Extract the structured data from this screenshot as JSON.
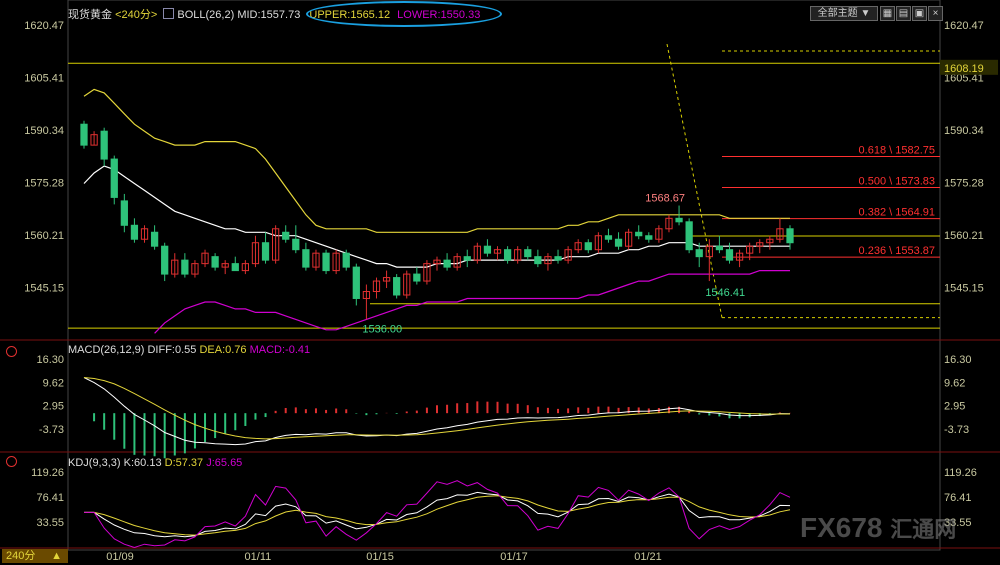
{
  "header": {
    "symbol": "现货黄金",
    "period": "<240分>",
    "indicator": "BOLL(26,2)",
    "mid": "MID:1557.73",
    "upper": "UPPER:1565.12",
    "lower": "LOWER:1550.33",
    "theme_label": "全部主题",
    "theme_arrow": "▼"
  },
  "macd_header": {
    "title": "MACD(26,12,9)",
    "diff": "DIFF:0.55",
    "dea": "DEA:0.76",
    "macd": "MACD:-0.41"
  },
  "kdj_header": {
    "title": "KDJ(9,3,3)",
    "k": "K:60.13",
    "d": "D:57.37",
    "j": "J:65.65"
  },
  "period_badge": "240分",
  "watermark": "FX678",
  "watermark_cn": "汇通网",
  "colors": {
    "up": "#e03030",
    "down": "#2ec27a",
    "boll_mid": "#ffffff",
    "boll_upper": "#e3d53a",
    "boll_lower": "#d000d0",
    "fib": "#ff3030",
    "level": "#d8d000"
  },
  "chart_data": [
    {
      "type": "candlestick",
      "title": "现货黄金 240分",
      "y_ticks": [
        "1620.47",
        "1605.41",
        "1590.34",
        "1575.28",
        "1560.21",
        "1545.15"
      ],
      "y_tick_values": [
        1620.47,
        1605.41,
        1590.34,
        1575.28,
        1560.21,
        1545.15
      ],
      "right_extra_tick": "1608.19",
      "ylim": [
        1532.5,
        1625
      ],
      "x_labels": [
        "01/09",
        "01/11",
        "01/15",
        "01/17",
        "01/21"
      ],
      "candles": [
        [
          1592,
          1593,
          1585,
          1586
        ],
        [
          1586,
          1590,
          1586,
          1589
        ],
        [
          1590,
          1591,
          1580,
          1582
        ],
        [
          1582,
          1583,
          1569,
          1571
        ],
        [
          1570,
          1572,
          1561,
          1563
        ],
        [
          1563,
          1565,
          1558,
          1559
        ],
        [
          1559,
          1563,
          1558,
          1562
        ],
        [
          1561,
          1563,
          1556,
          1557
        ],
        [
          1557,
          1558,
          1547,
          1549
        ],
        [
          1549,
          1555,
          1548,
          1553
        ],
        [
          1553,
          1555,
          1548,
          1549
        ],
        [
          1549,
          1553,
          1548,
          1552
        ],
        [
          1552,
          1556,
          1551,
          1555
        ],
        [
          1554,
          1555,
          1550,
          1551
        ],
        [
          1551,
          1553,
          1549,
          1552
        ],
        [
          1552,
          1554,
          1550,
          1550
        ],
        [
          1550,
          1553,
          1549,
          1552
        ],
        [
          1552,
          1560,
          1551,
          1558
        ],
        [
          1558,
          1561,
          1552,
          1553
        ],
        [
          1553,
          1563,
          1552,
          1562
        ],
        [
          1561,
          1563,
          1558,
          1559
        ],
        [
          1559,
          1563,
          1555,
          1556
        ],
        [
          1556,
          1558,
          1550,
          1551
        ],
        [
          1551,
          1556,
          1550,
          1555
        ],
        [
          1555,
          1556,
          1549,
          1550
        ],
        [
          1550,
          1556,
          1549,
          1555
        ],
        [
          1555,
          1556,
          1550,
          1551
        ],
        [
          1551,
          1552,
          1540,
          1542
        ],
        [
          1542,
          1546,
          1536,
          1544
        ],
        [
          1544,
          1548,
          1542,
          1547
        ],
        [
          1547,
          1550,
          1545,
          1548
        ],
        [
          1548,
          1549,
          1542,
          1543
        ],
        [
          1543,
          1550,
          1542,
          1549
        ],
        [
          1549,
          1551,
          1546,
          1547
        ],
        [
          1547,
          1553,
          1546,
          1552
        ],
        [
          1552,
          1554,
          1550,
          1553
        ],
        [
          1553,
          1555,
          1550,
          1551
        ],
        [
          1551,
          1555,
          1550,
          1554
        ],
        [
          1554,
          1556,
          1551,
          1553
        ],
        [
          1553,
          1558,
          1552,
          1557
        ],
        [
          1557,
          1559,
          1554,
          1555
        ],
        [
          1555,
          1557,
          1553,
          1556
        ],
        [
          1556,
          1557,
          1552,
          1553
        ],
        [
          1553,
          1557,
          1552,
          1556
        ],
        [
          1556,
          1557,
          1553,
          1554
        ],
        [
          1554,
          1556,
          1551,
          1552
        ],
        [
          1552,
          1555,
          1550,
          1554
        ],
        [
          1554,
          1556,
          1552,
          1553
        ],
        [
          1553,
          1557,
          1552,
          1556
        ],
        [
          1556,
          1559,
          1555,
          1558
        ],
        [
          1558,
          1559,
          1555,
          1556
        ],
        [
          1556,
          1561,
          1555,
          1560
        ],
        [
          1560,
          1562,
          1558,
          1559
        ],
        [
          1559,
          1561,
          1556,
          1557
        ],
        [
          1557,
          1562,
          1556,
          1561
        ],
        [
          1561,
          1563,
          1559,
          1560
        ],
        [
          1560,
          1561,
          1558,
          1559
        ],
        [
          1559,
          1563,
          1558,
          1562
        ],
        [
          1562,
          1566,
          1561,
          1565
        ],
        [
          1565,
          1568.67,
          1563,
          1564
        ],
        [
          1564,
          1565,
          1555,
          1556
        ],
        [
          1556,
          1558,
          1551,
          1554
        ],
        [
          1554,
          1559,
          1547,
          1557
        ],
        [
          1557,
          1560,
          1555,
          1556
        ],
        [
          1556,
          1558,
          1552,
          1553
        ],
        [
          1553,
          1556,
          1551,
          1555
        ],
        [
          1555,
          1558,
          1553,
          1557
        ],
        [
          1557,
          1559,
          1555,
          1558
        ],
        [
          1558,
          1560,
          1556,
          1559
        ],
        [
          1559,
          1565,
          1558,
          1562
        ],
        [
          1562,
          1563,
          1556,
          1558
        ]
      ],
      "boll": {
        "mid": [
          1575,
          1578,
          1580,
          1579,
          1577,
          1575,
          1573,
          1571,
          1569,
          1567,
          1566,
          1565,
          1564,
          1563,
          1562,
          1562,
          1561,
          1561,
          1561,
          1560,
          1560,
          1560,
          1559,
          1558,
          1557,
          1556,
          1555,
          1554,
          1553,
          1552,
          1552,
          1551,
          1551,
          1551,
          1551,
          1552,
          1552,
          1552,
          1553,
          1553,
          1553,
          1553,
          1553,
          1553,
          1553,
          1553,
          1553,
          1553,
          1554,
          1554,
          1554,
          1555,
          1555,
          1555,
          1556,
          1556,
          1557,
          1557,
          1558,
          1558,
          1558,
          1557,
          1557,
          1557,
          1557,
          1557,
          1557,
          1557,
          1557,
          1557,
          1557
        ],
        "upper": [
          1600,
          1602,
          1601,
          1598,
          1595,
          1592,
          1590,
          1588,
          1587,
          1586,
          1586,
          1586,
          1587,
          1587,
          1587,
          1587,
          1586,
          1585,
          1582,
          1578,
          1574,
          1570,
          1566,
          1563,
          1562,
          1562,
          1562,
          1562,
          1562,
          1561,
          1561,
          1561,
          1561,
          1561,
          1561,
          1561,
          1561,
          1561,
          1561,
          1562,
          1562,
          1562,
          1562,
          1562,
          1562,
          1562,
          1562,
          1562,
          1563,
          1563,
          1564,
          1564,
          1565,
          1566,
          1566,
          1566,
          1566,
          1566,
          1566,
          1566,
          1566,
          1566,
          1566,
          1566,
          1565,
          1565,
          1565,
          1565,
          1565,
          1565,
          1565
        ],
        "lower": [
          null,
          null,
          null,
          null,
          null,
          null,
          null,
          1532,
          1535,
          1537,
          1539,
          1540,
          1541,
          1541,
          1540,
          1539,
          1539,
          1538,
          1538,
          1538,
          1537,
          1536,
          1535,
          1534,
          1533,
          1533,
          1534,
          1535,
          1536,
          1537,
          1538,
          1539,
          1540,
          1540,
          1541,
          1541,
          1541,
          1541,
          1542,
          1542,
          1542,
          1542,
          1542,
          1542,
          1542,
          1542,
          1542,
          1542,
          1542,
          1542,
          1543,
          1543,
          1544,
          1545,
          1546,
          1547,
          1547,
          1548,
          1549,
          1549,
          1549,
          1549,
          1549,
          1549,
          1549,
          1549,
          1549,
          1550,
          1550,
          1550,
          1550
        ]
      },
      "fib_levels": [
        {
          "label": "0.618 \\ 1582.75",
          "value": 1582.75
        },
        {
          "label": "0.500 \\ 1573.83",
          "value": 1573.83
        },
        {
          "label": "0.382 \\ 1564.91",
          "value": 1564.91
        },
        {
          "label": "0.236 \\ 1553.87",
          "value": 1553.87
        }
      ],
      "annotations": [
        {
          "text": "1568.67",
          "value": 1568.67,
          "bar": 59
        },
        {
          "text": "1546.41",
          "value": 1546.41,
          "bar": 62
        },
        {
          "text": "1536.00",
          "value": 1536.0,
          "bar": 28
        }
      ]
    },
    {
      "type": "macd",
      "title": "MACD(26,12,9)",
      "y_ticks": [
        "16.30",
        "9.62",
        "2.95",
        "-3.73"
      ],
      "y_tick_values": [
        16.3,
        9.62,
        2.95,
        -3.73
      ],
      "ylim": [
        -9,
        18
      ]
    },
    {
      "type": "kdj",
      "title": "KDJ(9,3,3)",
      "y_ticks": [
        "119.26",
        "76.41",
        "33.55"
      ],
      "y_tick_values": [
        119.26,
        76.41,
        33.55
      ],
      "ylim": [
        0,
        135
      ]
    }
  ]
}
